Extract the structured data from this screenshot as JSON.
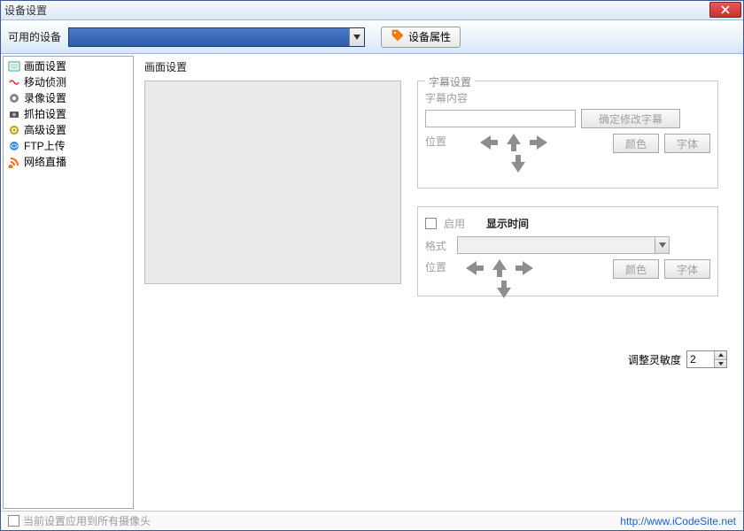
{
  "window": {
    "title": "设备设置"
  },
  "toolbar": {
    "available_label": "可用的设备",
    "props_button": "设备属性"
  },
  "sidebar": {
    "items": [
      {
        "label": "画面设置",
        "icon": "frame-icon"
      },
      {
        "label": "移动侦测",
        "icon": "motion-icon"
      },
      {
        "label": "录像设置",
        "icon": "record-icon"
      },
      {
        "label": "抓拍设置",
        "icon": "snapshot-icon"
      },
      {
        "label": "高级设置",
        "icon": "gear-icon"
      },
      {
        "label": "FTP上传",
        "icon": "ftp-icon"
      },
      {
        "label": "网络直播",
        "icon": "rss-icon"
      }
    ]
  },
  "content": {
    "title": "画面设置",
    "subtitle_group": {
      "legend": "字幕设置",
      "content_label": "字幕内容",
      "confirm_btn": "确定修改字幕",
      "position_label": "位置",
      "color_btn": "颜色",
      "font_btn": "字体"
    },
    "time_group": {
      "enable_label": "启用",
      "title": "显示时间",
      "format_label": "格式",
      "position_label": "位置",
      "color_btn": "颜色",
      "font_btn": "字体"
    },
    "sensitivity": {
      "label": "调整灵敏度",
      "value": "2"
    }
  },
  "footer": {
    "apply_all_label": "当前设置应用到所有摄像头",
    "link": "http://www.iCodeSite.net"
  }
}
